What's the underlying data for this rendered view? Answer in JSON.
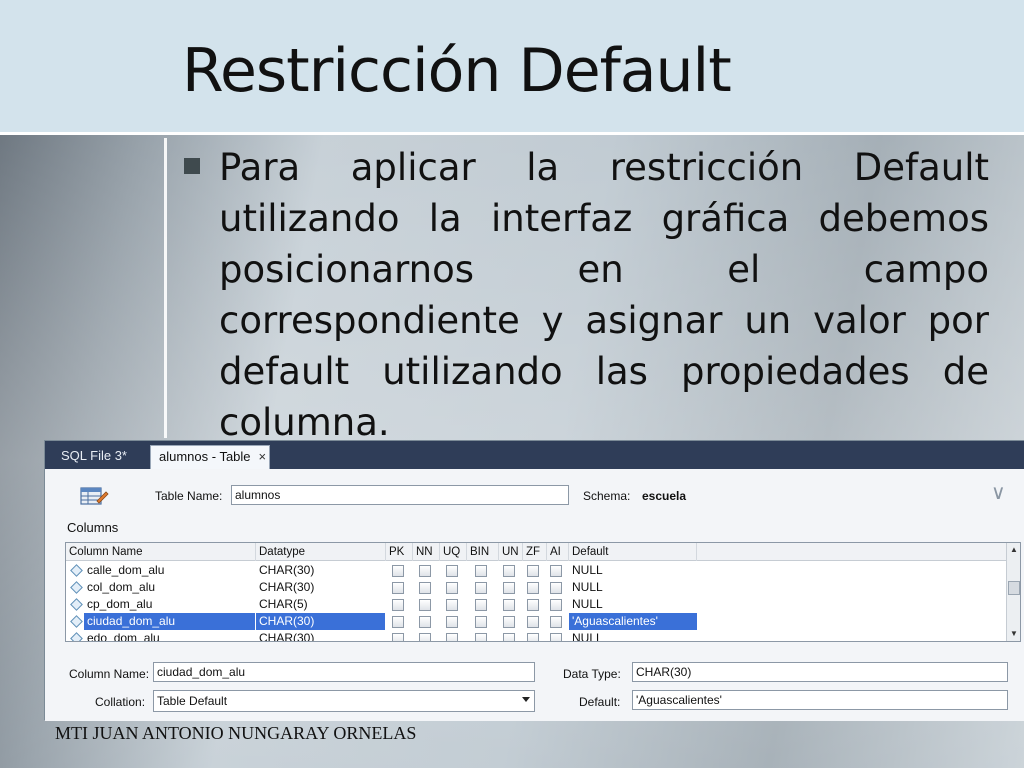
{
  "slide": {
    "title": "Restricción Default",
    "bullet": "Para aplicar la restricción Default utilizando la interfaz gráfica debemos posicionarnos en el campo correspondiente y asignar un valor por default utilizando las propiedades de columna.",
    "footer": "MTI JUAN ANTONIO NUNGARAY ORNELAS"
  },
  "tabs": [
    {
      "label": "SQL File 3*"
    },
    {
      "label": "alumnos - Table",
      "close": "×"
    }
  ],
  "table_header": {
    "table_name_label": "Table Name:",
    "table_name_value": "alumnos",
    "schema_label": "Schema:",
    "schema_value": "escuela",
    "collapse_icon": "double-chevron-down-icon"
  },
  "columns": {
    "section_label": "Columns",
    "headers": [
      "Column Name",
      "Datatype",
      "PK",
      "NN",
      "UQ",
      "BIN",
      "UN",
      "ZF",
      "AI",
      "Default"
    ],
    "rows": [
      {
        "name": "calle_dom_alu",
        "type": "CHAR(30)",
        "default": "NULL",
        "selected": false
      },
      {
        "name": "col_dom_alu",
        "type": "CHAR(30)",
        "default": "NULL",
        "selected": false
      },
      {
        "name": "cp_dom_alu",
        "type": "CHAR(5)",
        "default": "NULL",
        "selected": false
      },
      {
        "name": "ciudad_dom_alu",
        "type": "CHAR(30)",
        "default": "'Aguascalientes'",
        "selected": true
      },
      {
        "name": "edo_dom_alu",
        "type": "CHAR(30)",
        "default": "NULL",
        "selected": false
      }
    ]
  },
  "details": {
    "column_name_label": "Column Name:",
    "column_name_value": "ciudad_dom_alu",
    "collation_label": "Collation:",
    "collation_value": "Table Default",
    "data_type_label": "Data Type:",
    "data_type_value": "CHAR(30)",
    "default_label": "Default:",
    "default_value": "'Aguascalientes'"
  },
  "colors": {
    "tab_bar": "#2f3d58",
    "selection": "#3a70d8",
    "title_band": "#d3e3ec"
  }
}
